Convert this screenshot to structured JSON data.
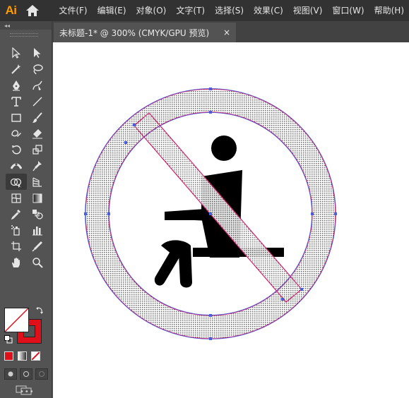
{
  "app": {
    "logo": "Ai",
    "home_icon": "home-icon"
  },
  "menu": [
    "文件(F)",
    "编辑(E)",
    "对象(O)",
    "文字(T)",
    "选择(S)",
    "效果(C)",
    "视图(V)",
    "窗口(W)",
    "帮助(H)"
  ],
  "toolbox": {
    "collapse": "◂◂",
    "tools": [
      "selection-tool-icon",
      "direct-selection-tool-icon",
      "magic-wand-tool-icon",
      "lasso-tool-icon",
      "pen-tool-icon",
      "curvature-tool-icon",
      "type-tool-icon",
      "line-segment-tool-icon",
      "rectangle-tool-icon",
      "paintbrush-tool-icon",
      "shaper-tool-icon",
      "eraser-tool-icon",
      "rotate-tool-icon",
      "scale-tool-icon",
      "width-tool-icon",
      "puppet-warp-tool-icon",
      "shape-builder-tool-icon",
      "perspective-grid-tool-icon",
      "mesh-tool-icon",
      "gradient-tool-icon",
      "eyedropper-tool-icon",
      "blend-tool-icon",
      "symbol-sprayer-tool-icon",
      "column-graph-tool-icon",
      "artboard-tool-icon",
      "slice-tool-icon",
      "hand-tool-icon",
      "zoom-tool-icon"
    ],
    "active_tool_index": 16,
    "more": "•••"
  },
  "colors": {
    "fill": "#ffffff",
    "stroke": "#e0101a",
    "selection": "#4a5fe0",
    "path_outline": "#d0206a"
  },
  "tab": {
    "title": "未标题-1* @ 300% (CMYK/GPU 预览)",
    "close": "×"
  }
}
